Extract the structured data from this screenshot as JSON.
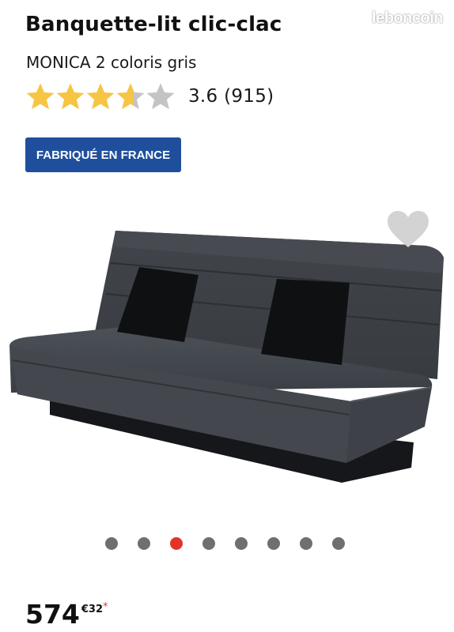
{
  "watermark": "leboncoin",
  "product": {
    "title": "Banquette-lit clic-clac",
    "subtitle": "MONICA 2 coloris gris",
    "rating": {
      "value": 3.6,
      "stars_max": 5,
      "text": "3.6 (915)"
    },
    "badge": "FABRIQUÉ EN FRANCE",
    "favorite_icon": "heart-icon",
    "carousel": {
      "count": 8,
      "active_index": 2
    },
    "price": {
      "integer": "574",
      "decimal": "€32",
      "asterisk": "*"
    }
  },
  "colors": {
    "star_filled": "#f6c544",
    "star_empty": "#c4c4c4",
    "badge": "#1f4f9c",
    "dot_active": "#e5332a",
    "dot_inactive": "#6f6f6f"
  }
}
